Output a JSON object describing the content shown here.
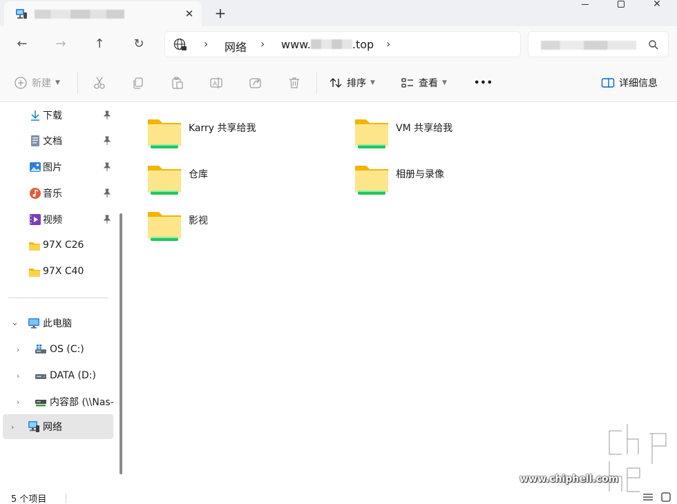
{
  "window": {
    "tab_title": "",
    "close_glyph": "✕",
    "new_tab_glyph": "+",
    "close_window_glyph": "✕"
  },
  "nav": {
    "back_glyph": "←",
    "forward_glyph": "→",
    "up_glyph": "↑",
    "refresh_glyph": "↻"
  },
  "address": {
    "crumbs": [
      "网络",
      "www.",
      ".top"
    ],
    "sep_glyph": "›"
  },
  "toolbar": {
    "new_label": "新建",
    "sort_label": "排序",
    "view_label": "查看",
    "more_glyph": "•••",
    "details_label": "详细信息"
  },
  "sidebar": {
    "quick": [
      {
        "label": "下载",
        "icon": "download-icon"
      },
      {
        "label": "文档",
        "icon": "document-icon"
      },
      {
        "label": "图片",
        "icon": "pictures-icon"
      },
      {
        "label": "音乐",
        "icon": "music-icon"
      },
      {
        "label": "视频",
        "icon": "videos-icon"
      },
      {
        "label": "97X C26",
        "icon": "folder-icon"
      },
      {
        "label": "97X C40",
        "icon": "folder-icon"
      }
    ],
    "tree": [
      {
        "label": "此电脑",
        "icon": "this-pc-icon",
        "expanded": true
      },
      {
        "label": "OS (C:)",
        "icon": "drive-icon"
      },
      {
        "label": "DATA (D:)",
        "icon": "drive-icon"
      },
      {
        "label": "内容部 (\\\\Nas-",
        "icon": "network-drive-icon"
      },
      {
        "label": "网络",
        "icon": "network-icon",
        "selected": true
      }
    ],
    "chev_right": "›",
    "chev_down": "⌄"
  },
  "content": {
    "folders": [
      {
        "name": "Karry 共享给我"
      },
      {
        "name": "VM 共享给我"
      },
      {
        "name": "仓库"
      },
      {
        "name": "相册与录像"
      },
      {
        "name": "影视"
      }
    ]
  },
  "status": {
    "item_count": "5 个项目"
  },
  "watermark": {
    "url": "www.chiphell.com",
    "logo_text": "chip hell"
  },
  "colors": {
    "folder_yellow": "#f7c948",
    "folder_light": "#fde68a",
    "share_green": "#22c55e",
    "accent_blue": "#0067c0"
  }
}
